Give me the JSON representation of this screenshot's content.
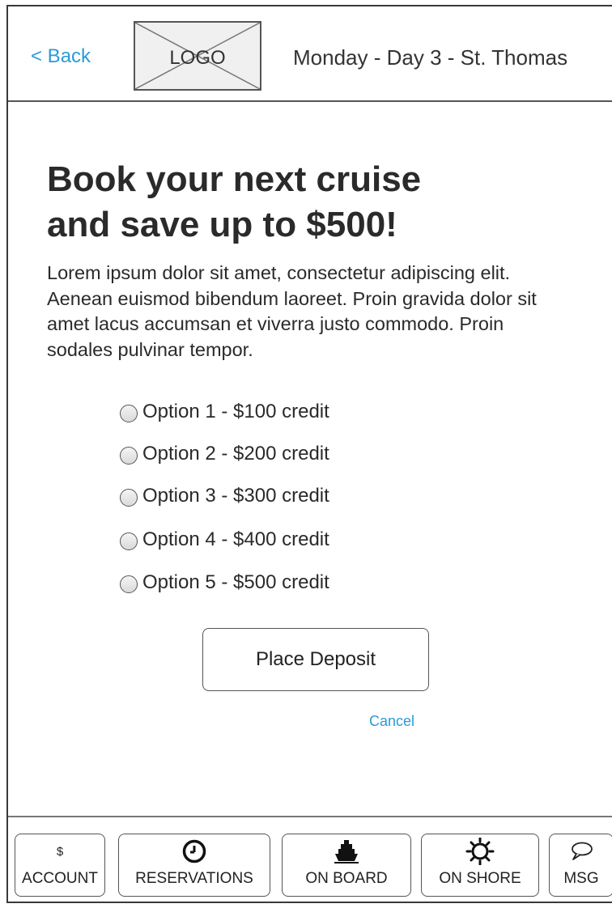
{
  "header": {
    "back_label": "< Back",
    "logo_label": "LOGO",
    "title": "Monday - Day 3 - St. Thomas"
  },
  "promo": {
    "headline": "Book your next cruise\nand save up to $500!",
    "body": "Lorem ipsum dolor sit amet, consectetur adipiscing elit. Aenean euismod bibendum laoreet. Proin gravida dolor sit amet lacus accumsan et viverra justo commodo. Proin sodales pulvinar tempor."
  },
  "options": [
    {
      "label": "Option 1 - $100 credit",
      "selected": false
    },
    {
      "label": "Option 2 - $200 credit",
      "selected": false
    },
    {
      "label": "Option 3 - $300 credit",
      "selected": false
    },
    {
      "label": "Option 4 - $400 credit",
      "selected": false
    },
    {
      "label": "Option 5 - $500 credit",
      "selected": false
    }
  ],
  "actions": {
    "deposit_label": "Place Deposit",
    "cancel_label": "Cancel"
  },
  "tabbar": {
    "tabs": [
      {
        "label": "ACCOUNT",
        "icon": "dollar-icon",
        "icon_text": "$"
      },
      {
        "label": "RESERVATIONS",
        "icon": "clock-icon"
      },
      {
        "label": "ON BOARD",
        "icon": "ship-icon"
      },
      {
        "label": "ON SHORE",
        "icon": "sun-icon"
      },
      {
        "label": "MSG",
        "icon": "speech-bubble-icon"
      }
    ]
  },
  "colors": {
    "link": "#2b9bd6",
    "border": "#555555",
    "text": "#2a2a2a"
  }
}
